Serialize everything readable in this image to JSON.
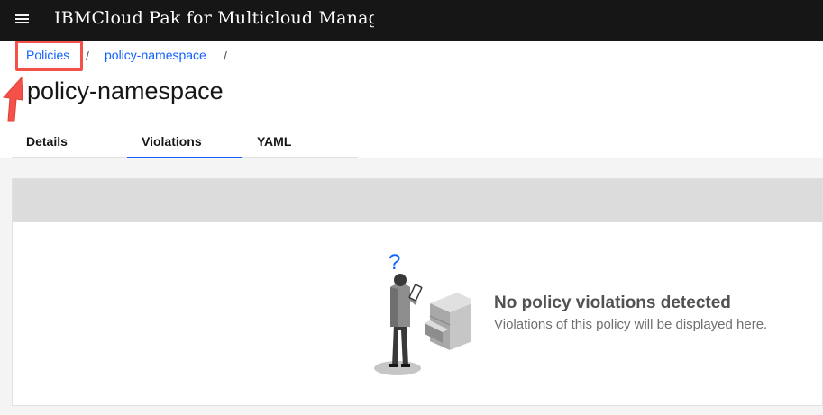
{
  "header": {
    "menu_icon": "hamburger-menu-icon",
    "product_name": "IBMCloud Pak for Multicloud Management"
  },
  "breadcrumb": {
    "items": [
      {
        "label": "Policies"
      },
      {
        "label": "policy-namespace"
      }
    ],
    "separator": "/"
  },
  "page": {
    "title": "policy-namespace"
  },
  "tabs": [
    {
      "label": "Details",
      "selected": false
    },
    {
      "label": "Violations",
      "selected": true
    },
    {
      "label": "YAML",
      "selected": false
    }
  ],
  "empty_state": {
    "illustration": "person-with-filing-cabinet-illustration",
    "question_mark": "?",
    "title": "No policy violations detected",
    "description": "Violations of this policy will be displayed here."
  },
  "annotation": {
    "highlight_color": "#f4514a",
    "arrow_icon": "red-arrow-icon"
  },
  "colors": {
    "link": "#0f62fe",
    "header_bg": "#161616",
    "selected_tab_indicator": "#0f62fe"
  }
}
